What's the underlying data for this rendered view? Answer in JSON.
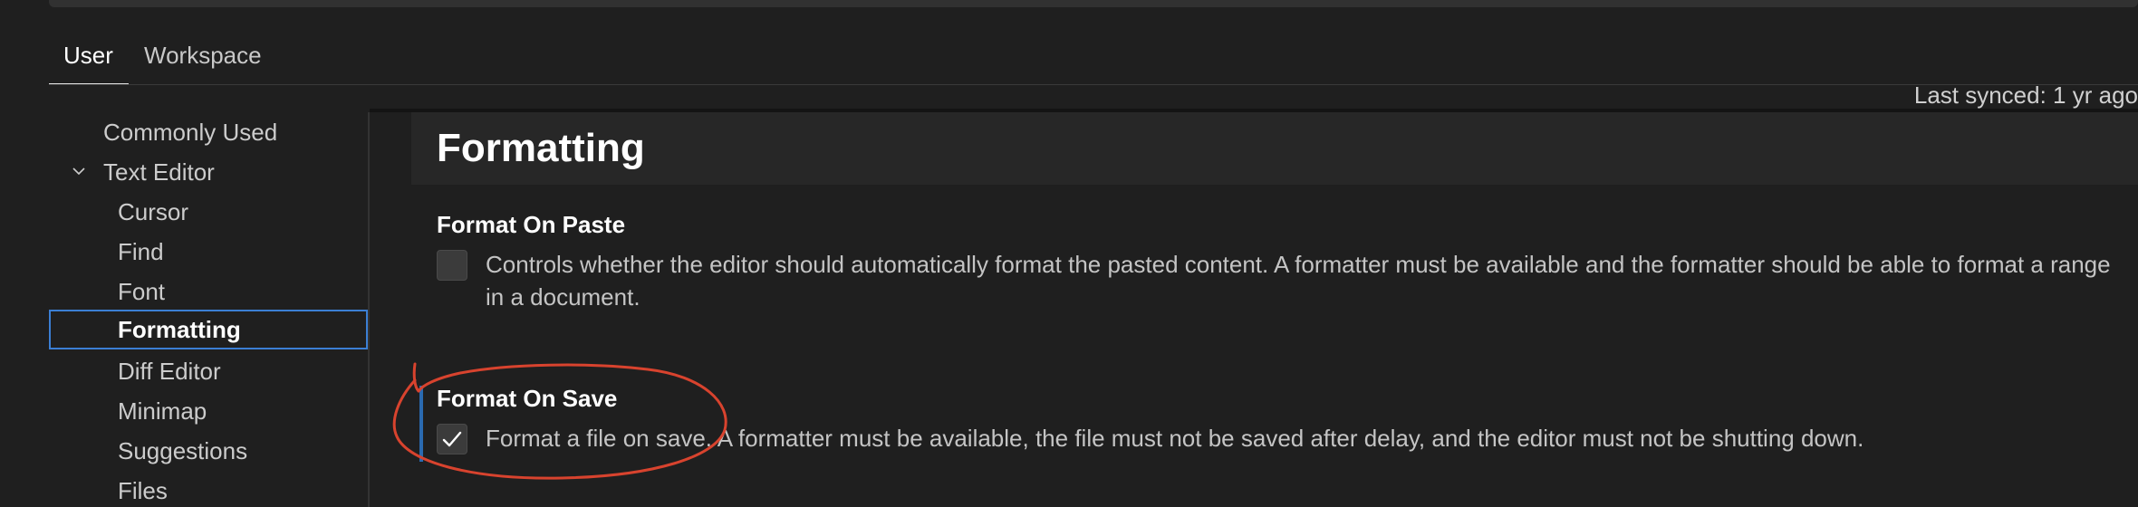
{
  "tabs": {
    "user": "User",
    "workspace": "Workspace",
    "sync_status": "Last synced: 1 yr ago"
  },
  "toc": {
    "items": [
      {
        "label": "Commonly Used",
        "level": 0
      },
      {
        "label": "Text Editor",
        "level": 0,
        "expanded": true
      },
      {
        "label": "Cursor",
        "level": 1
      },
      {
        "label": "Find",
        "level": 1
      },
      {
        "label": "Font",
        "level": 1
      },
      {
        "label": "Formatting",
        "level": 1,
        "selected": true
      },
      {
        "label": "Diff Editor",
        "level": 1
      },
      {
        "label": "Minimap",
        "level": 1
      },
      {
        "label": "Suggestions",
        "level": 1
      },
      {
        "label": "Files",
        "level": 1
      }
    ]
  },
  "section": {
    "title": "Formatting"
  },
  "settings": [
    {
      "title": "Format On Paste",
      "checked": false,
      "description": "Controls whether the editor should automatically format the pasted content. A formatter must be available and the formatter should be able to format a range in a document."
    },
    {
      "title": "Format On Save",
      "checked": true,
      "modified": true,
      "description": "Format a file on save. A formatter must be available, the file must not be saved after delay, and the editor must not be shutting down."
    }
  ],
  "colors": {
    "background": "#1f1f1f",
    "selection_border": "#3b7fd4",
    "modified_indicator": "#2a6ab0",
    "annotation_red": "#d8432e"
  },
  "icons": {
    "expand": "chevron-down-icon",
    "check": "check-icon"
  }
}
